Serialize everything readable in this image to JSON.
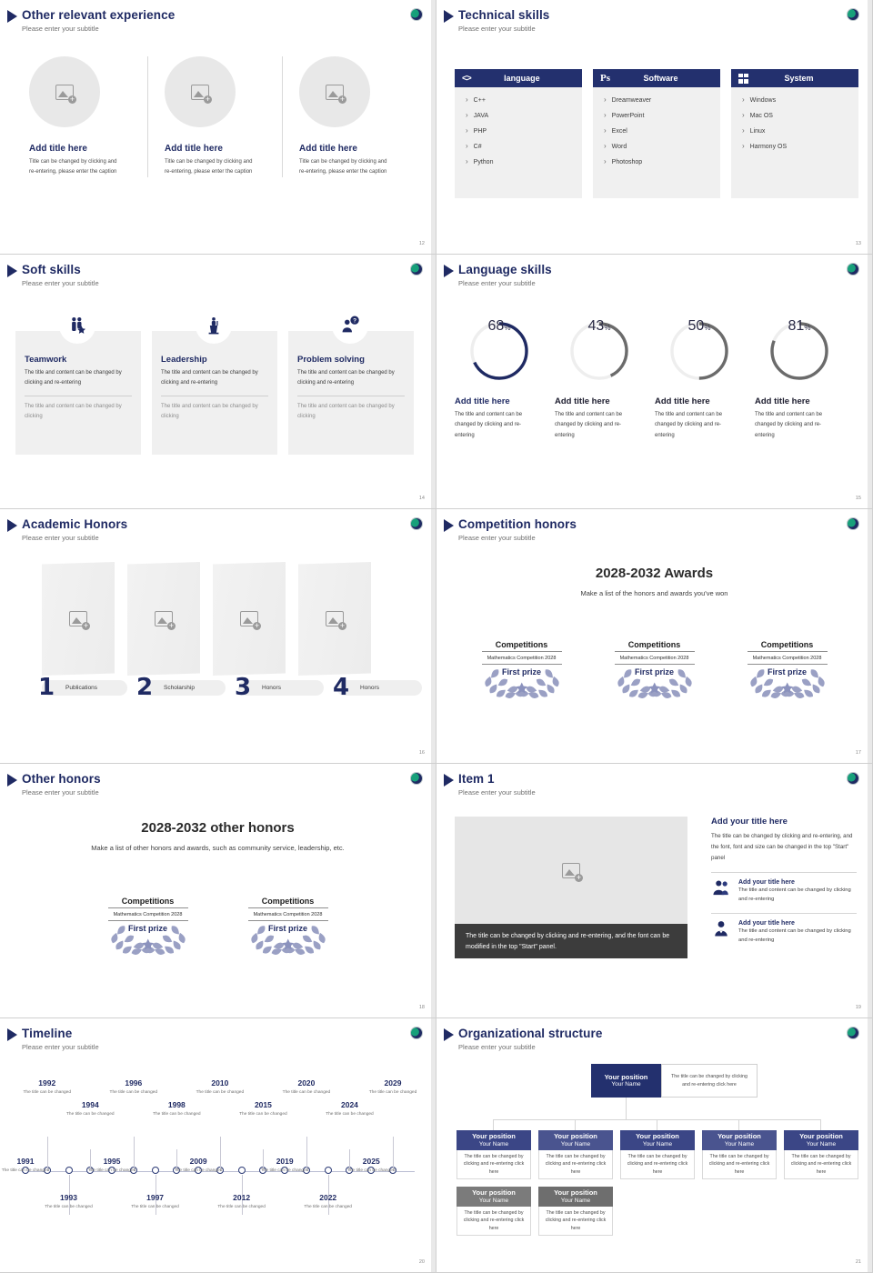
{
  "common": {
    "subtitle": "Please enter your subtitle",
    "logo_icon": "globe-logo-icon",
    "placeholder_icon": "image-placeholder-icon"
  },
  "slides": [
    {
      "id": "other-relevant-experience",
      "title": "Other relevant experience",
      "subtitle": "Please enter your subtitle",
      "page": "12",
      "columns": [
        {
          "title": "Add title here",
          "desc": "Title can be changed by clicking and re-entering, please enter the caption"
        },
        {
          "title": "Add title here",
          "desc": "Title can be changed by clicking and re-entering, please enter the caption"
        },
        {
          "title": "Add title here",
          "desc": "Title can be changed by clicking and re-entering, please enter the caption"
        }
      ]
    },
    {
      "id": "technical-skills",
      "title": "Technical skills",
      "subtitle": "Please enter your subtitle",
      "page": "13",
      "cards": [
        {
          "icon": "code-brackets-icon",
          "header": "language",
          "items": [
            "C++",
            "JAVA",
            "PHP",
            "C#",
            "Python"
          ]
        },
        {
          "icon": "photoshop-ps-icon",
          "header": "Software",
          "items": [
            "Dreamweaver",
            "PowerPoint",
            "Excel",
            "Word",
            "Photoshop"
          ]
        },
        {
          "icon": "windows-logo-icon",
          "header": "System",
          "items": [
            "Windows",
            "Mac OS",
            "Linux",
            "Harmony OS"
          ]
        }
      ]
    },
    {
      "id": "soft-skills",
      "title": "Soft skills",
      "subtitle": "Please enter your subtitle",
      "page": "14",
      "cards": [
        {
          "icon": "teamwork-people-star-icon",
          "title": "Teamwork",
          "desc": "The title and content can be changed by clicking and re-entering",
          "desc2": "The title and content can be changed by clicking"
        },
        {
          "icon": "leadership-podium-icon",
          "title": "Leadership",
          "desc": "The title and content can be changed by clicking and re-entering",
          "desc2": "The title and content can be changed by clicking"
        },
        {
          "icon": "problem-solving-question-icon",
          "title": "Problem solving",
          "desc": "The title and content can be changed by clicking and re-entering",
          "desc2": "The title and content can be changed by clicking"
        }
      ]
    },
    {
      "id": "language-skills",
      "title": "Language skills",
      "subtitle": "Please enter your subtitle",
      "page": "15",
      "accent_navy": "#1f2a63",
      "accent_gray": "#6b6b6b",
      "track": "#eeeeee",
      "rings": [
        {
          "value": 68,
          "unit": "%",
          "color": "#1f2a63",
          "title": "Add title here",
          "desc": "The title and content can be changed by clicking and re-entering"
        },
        {
          "value": 43,
          "unit": "%",
          "color": "#6b6b6b",
          "title": "Add title here",
          "desc": "The title and content can be changed by clicking and re-entering"
        },
        {
          "value": 50,
          "unit": "%",
          "color": "#6b6b6b",
          "title": "Add title here",
          "desc": "The title and content can be changed by clicking and re-entering"
        },
        {
          "value": 81,
          "unit": "%",
          "color": "#6b6b6b",
          "title": "Add title here",
          "desc": "The title and content can be changed by clicking and re-entering"
        }
      ]
    },
    {
      "id": "academic-honors",
      "title": "Academic Honors",
      "subtitle": "Please enter your subtitle",
      "page": "16",
      "items": [
        {
          "num": "1",
          "label": "Publications"
        },
        {
          "num": "2",
          "label": "Scholarship"
        },
        {
          "num": "3",
          "label": "Honors"
        },
        {
          "num": "4",
          "label": "Honors"
        }
      ]
    },
    {
      "id": "competition-honors",
      "title": "Competition honors",
      "subtitle": "Please enter your subtitle",
      "page": "17",
      "heading": "2028-2032 Awards",
      "subheading": "Make a list of the honors and awards you've won",
      "wreaths": [
        {
          "head": "Competitions",
          "meta": "Mathematics Competition 2028",
          "prize": "First prize"
        },
        {
          "head": "Competitions",
          "meta": "Mathematics Competition 2028",
          "prize": "First prize"
        },
        {
          "head": "Competitions",
          "meta": "Mathematics Competition 2028",
          "prize": "First prize"
        }
      ]
    },
    {
      "id": "other-honors",
      "title": "Other honors",
      "subtitle": "Please enter your subtitle",
      "page": "18",
      "heading": "2028-2032 other honors",
      "subheading": "Make a list of other honors and awards, such as community service, leadership, etc.",
      "wreaths": [
        {
          "head": "Competitions",
          "meta": "Mathematics Competition 2028",
          "prize": "First prize"
        },
        {
          "head": "Competitions",
          "meta": "Mathematics Competition 2028",
          "prize": "First prize"
        }
      ]
    },
    {
      "id": "item-1",
      "title": "Item 1",
      "subtitle": "Please enter your subtitle",
      "page": "19",
      "caption": "The title can be changed by clicking and re-entering, and the font can be modified in the top \"Start\" panel.",
      "right_title": "Add your title here",
      "right_desc": "The title can be changed by clicking and re-entering, and the font, font and size can be changed in the top \"Start\" panel",
      "items": [
        {
          "icon": "two-people-icon",
          "title": "Add your title here",
          "desc": "The title and content can be changed by clicking and re-entering"
        },
        {
          "icon": "single-person-icon",
          "title": "Add your title here",
          "desc": "The title and content can be changed by clicking and re-entering"
        }
      ]
    },
    {
      "id": "timeline",
      "title": "Timeline",
      "subtitle": "Please enter your subtitle",
      "page": "20",
      "node_desc": "The title can be changed",
      "above": [
        {
          "year": "1992",
          "node": 1,
          "tier": 0
        },
        {
          "year": "1994",
          "node": 3,
          "tier": 1
        },
        {
          "year": "1996",
          "node": 5,
          "tier": 0
        },
        {
          "year": "1998",
          "node": 7,
          "tier": 1
        },
        {
          "year": "2010",
          "node": 9,
          "tier": 0
        },
        {
          "year": "2015",
          "node": 11,
          "tier": 1
        },
        {
          "year": "2020",
          "node": 13,
          "tier": 0
        },
        {
          "year": "2024",
          "node": 15,
          "tier": 1
        },
        {
          "year": "2029",
          "node": 17,
          "tier": 0
        }
      ],
      "below": [
        {
          "year": "1991",
          "node": 0,
          "tier": 0
        },
        {
          "year": "1993",
          "node": 2,
          "tier": 1
        },
        {
          "year": "1995",
          "node": 4,
          "tier": 0
        },
        {
          "year": "1997",
          "node": 6,
          "tier": 1
        },
        {
          "year": "2009",
          "node": 8,
          "tier": 0
        },
        {
          "year": "2012",
          "node": 10,
          "tier": 1
        },
        {
          "year": "2019",
          "node": 12,
          "tier": 0
        },
        {
          "year": "2022",
          "node": 14,
          "tier": 1
        },
        {
          "year": "2025",
          "node": 16,
          "tier": 0
        }
      ]
    },
    {
      "id": "organizational-structure",
      "title": "Organizational structure",
      "subtitle": "Please enter your subtitle",
      "page": "21",
      "root": {
        "position": "Your position",
        "name": "Your Name"
      },
      "root_note": "The title can be changed by clicking and re-entering click here",
      "row1": [
        {
          "position": "Your position",
          "name": "Your Name",
          "note": "The title can be changed by clicking and re-entering click here",
          "color": "#3b4686"
        },
        {
          "position": "Your position",
          "name": "Your Name",
          "note": "The title can be changed by clicking and re-entering click here",
          "color": "#4a548f"
        },
        {
          "position": "Your position",
          "name": "Your Name",
          "note": "The title can be changed by clicking and re-entering click here",
          "color": "#3b4686"
        },
        {
          "position": "Your position",
          "name": "Your Name",
          "note": "The title can be changed by clicking and re-entering click here",
          "color": "#4a548f"
        },
        {
          "position": "Your position",
          "name": "Your Name",
          "note": "The title can be changed by clicking and re-entering click here",
          "color": "#3b4686"
        }
      ],
      "row2": [
        {
          "position": "Your position",
          "name": "Your Name",
          "note": "The title can be changed by clicking and re-entering click here",
          "color": "#7b7b7b"
        },
        {
          "position": "Your position",
          "name": "Your Name",
          "note": "The title can be changed by clicking and re-entering click here",
          "color": "#6e6e6e"
        }
      ]
    }
  ]
}
